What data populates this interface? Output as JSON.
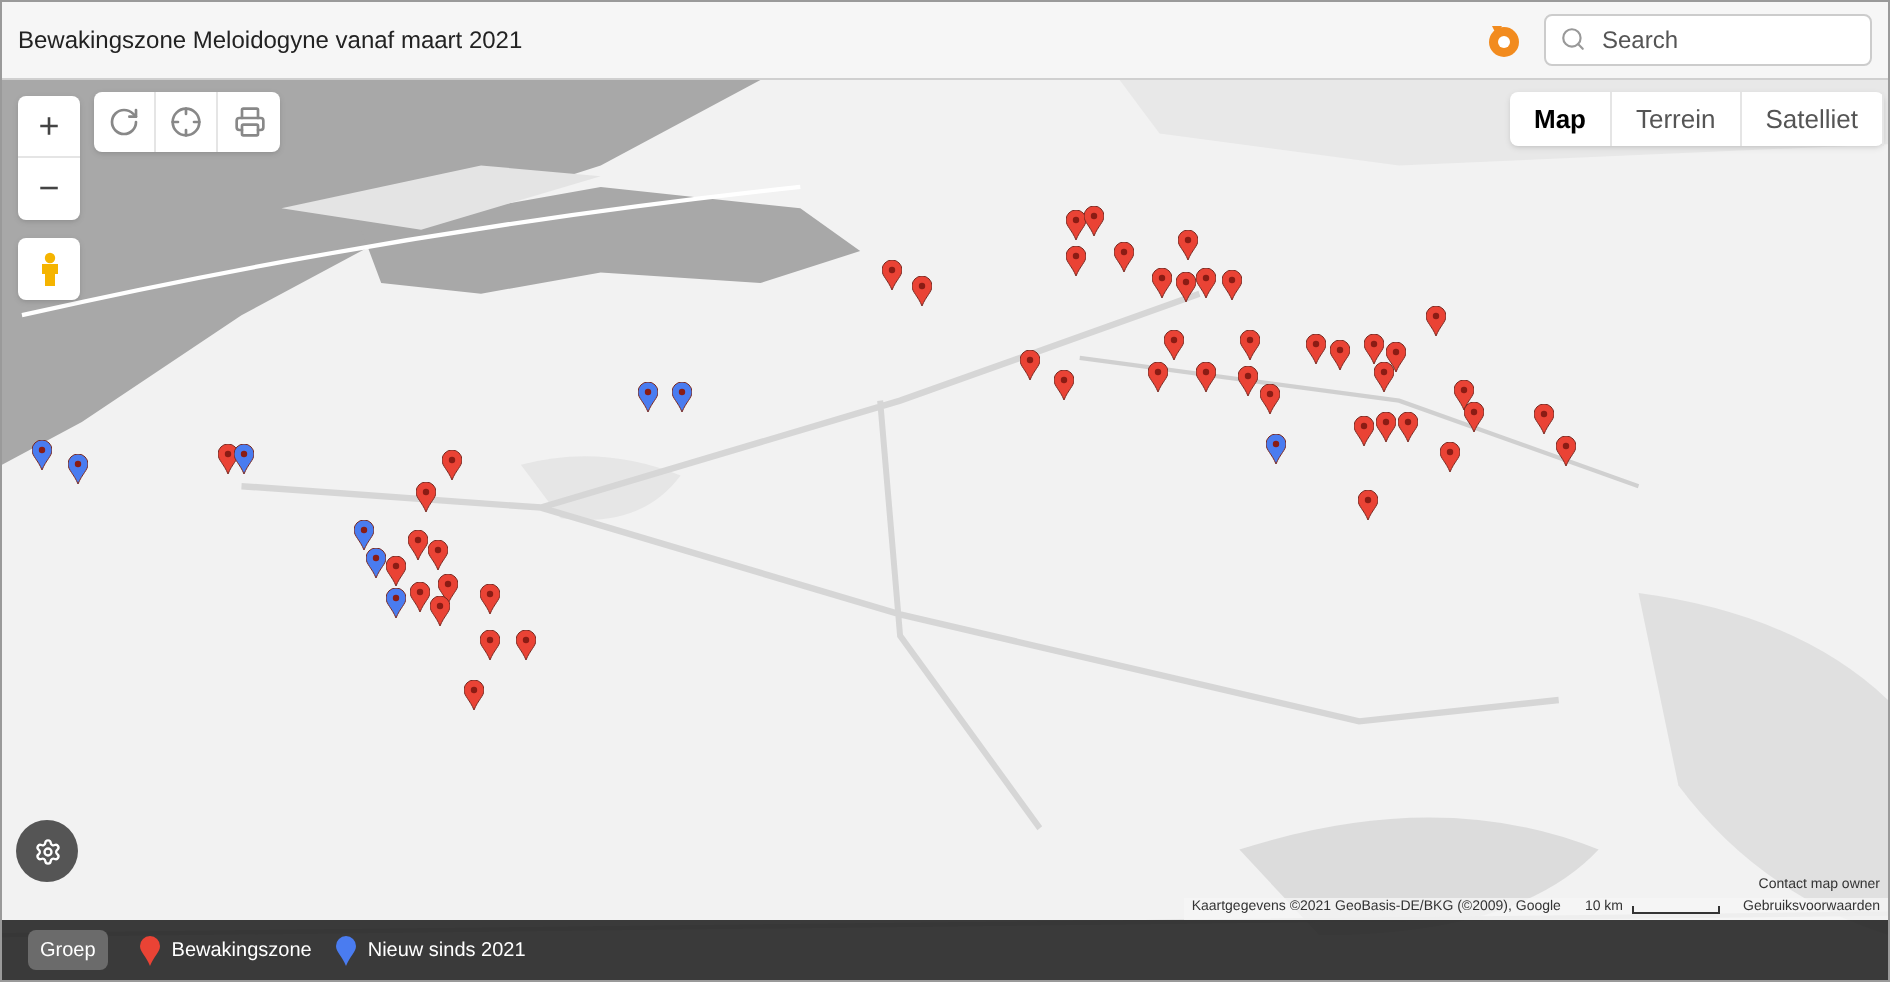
{
  "header": {
    "title": "Bewakingszone Meloidogyne vanaf maart 2021",
    "search": {
      "placeholder": "Search"
    }
  },
  "zoom": {
    "in": "+",
    "out": "−"
  },
  "map_types": [
    {
      "label": "Map",
      "selected": true
    },
    {
      "label": "Terrein",
      "selected": false
    },
    {
      "label": "Satelliet",
      "selected": false
    }
  ],
  "attribution": {
    "data": "Kaartgegevens ©2021 GeoBasis-DE/BKG (©2009), Google",
    "scale": "10 km",
    "terms": "Gebruiksvoorwaarden",
    "contact": "Contact map owner"
  },
  "legend": {
    "group_button": "Groep",
    "items": [
      {
        "label": "Bewakingszone",
        "color": "#ea4335"
      },
      {
        "label": "Nieuw sinds 2021",
        "color": "#4a7cf0"
      }
    ]
  }
}
